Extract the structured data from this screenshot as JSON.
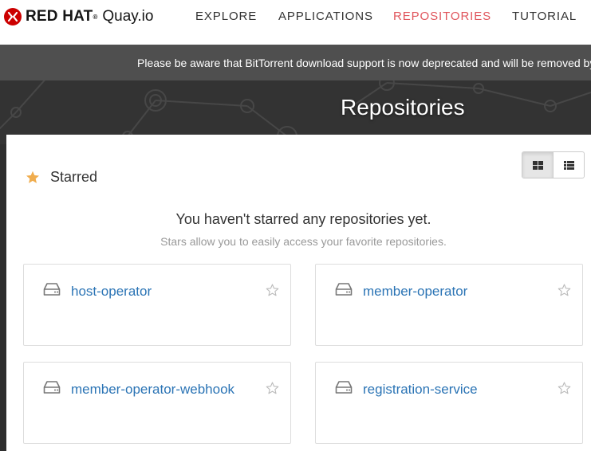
{
  "brand": {
    "name": "RED HAT",
    "product": "Quay.io"
  },
  "nav": {
    "items": [
      {
        "label": "EXPLORE"
      },
      {
        "label": "APPLICATIONS"
      },
      {
        "label": "REPOSITORIES"
      },
      {
        "label": "TUTORIAL"
      }
    ],
    "active": "REPOSITORIES"
  },
  "banner": {
    "text": "Please be aware that BitTorrent download support is now deprecated and will be removed by"
  },
  "page": {
    "title": "Repositories"
  },
  "starred": {
    "label": "Starred",
    "empty_title": "You haven't starred any repositories yet.",
    "empty_subtitle": "Stars allow you to easily access your favorite repositories."
  },
  "view_toggle": {
    "selected": "grid",
    "options": [
      "grid-icon",
      "list-icon"
    ]
  },
  "repositories": [
    {
      "name": "host-operator"
    },
    {
      "name": "member-operator"
    },
    {
      "name": "member-operator-webhook"
    },
    {
      "name": "registration-service"
    }
  ],
  "colors": {
    "accent": "#e0555c",
    "link": "#2b74b5",
    "brand_red": "#cc0000",
    "star": "#f0ad4e",
    "banner_bg": "#4f4f4f",
    "header_bg": "#333333"
  }
}
